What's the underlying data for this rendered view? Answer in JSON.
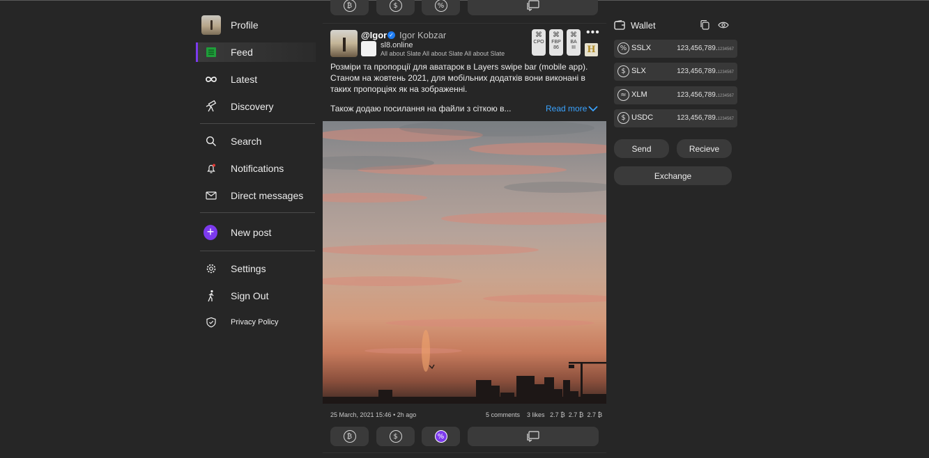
{
  "sidebar": {
    "profile": "Profile",
    "feed": "Feed",
    "latest": "Latest",
    "discovery": "Discovery",
    "search": "Search",
    "notifications": "Notifications",
    "direct_messages": "Direct messages",
    "new_post": "New post",
    "settings": "Settings",
    "sign_out": "Sign Out",
    "privacy_policy": "Privacy Policy"
  },
  "post": {
    "handle": "@Igor",
    "full_name": "Igor Kobzar",
    "site_name": "sl8.online",
    "site_description": "All about Slate All about Slate All about Slate",
    "badges": [
      {
        "line1": "CPO",
        "line2": ""
      },
      {
        "line1": "FBP",
        "line2": "86"
      },
      {
        "line1": "BA",
        "line2": "III"
      }
    ],
    "h_badge": "H",
    "text": "Розміри та пропорції для аватарок в Layers swipe bar (mobile app). Станом на жовтень 2021, для мобільних додатків вони виконані в таких пропорціях як на зображенні.",
    "text_continued": "Також додаю посилання на файли з сіткою в...",
    "read_more": "Read more",
    "date": "25 March, 2021 15:46",
    "ago": "2h ago",
    "comments": "5 comments",
    "likes": "3  likes",
    "stats": [
      "2.7 ₿",
      "2.7 ₿",
      "2.7 ₿"
    ]
  },
  "wallet": {
    "title": "Wallet",
    "coins": [
      {
        "name": "SSLX",
        "value": "123,456,789.",
        "decimals": "1234567",
        "icon": "sslx-coin-icon"
      },
      {
        "name": "SLX",
        "value": "123,456,789.",
        "decimals": "1234567",
        "icon": "slx-coin-icon"
      },
      {
        "name": "XLM",
        "value": "123,456,789.",
        "decimals": "1234567",
        "icon": "xlm-coin-icon"
      },
      {
        "name": "USDC",
        "value": "123,456,789.",
        "decimals": "1234567",
        "icon": "usdc-coin-icon"
      }
    ],
    "send": "Send",
    "receive": "Recieve",
    "exchange": "Exchange"
  },
  "colors": {
    "background": "#262626",
    "accent": "#7c3aed",
    "link": "#3aa3ff",
    "verified": "#1e7cf2"
  }
}
